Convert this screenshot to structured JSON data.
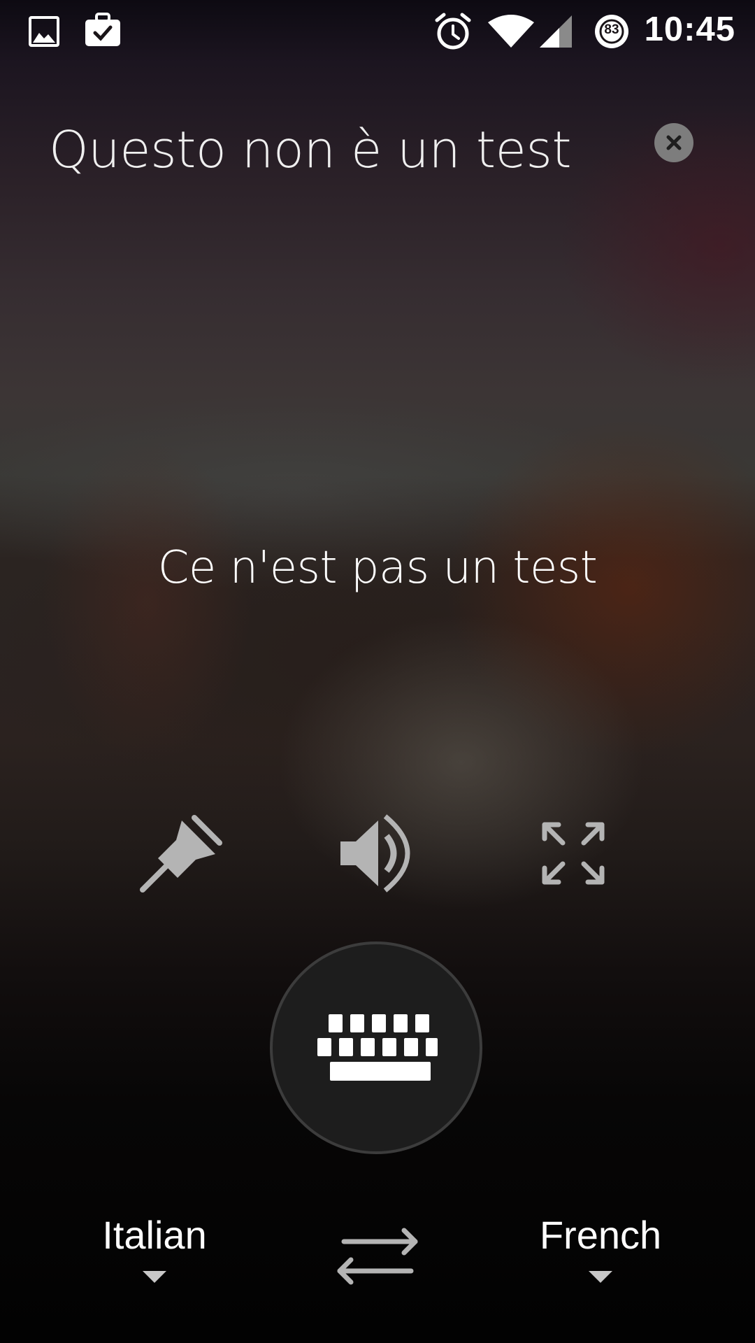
{
  "status_bar": {
    "time": "10:45",
    "battery_level": "83",
    "icons": [
      "image-icon",
      "briefcase-check-icon",
      "alarm-icon",
      "wifi-icon",
      "cell-signal-icon",
      "battery-saver-icon"
    ]
  },
  "translation": {
    "source_text": "Questo non è un test",
    "translated_text": "Ce n'est pas un test"
  },
  "actions": {
    "icons": [
      "pin-icon",
      "speaker-icon",
      "fullscreen-icon"
    ],
    "input_mode_icon": "keyboard-icon"
  },
  "languages": {
    "source": "Italian",
    "target": "French",
    "swap_icon": "swap-arrows-icon"
  },
  "colors": {
    "text": "#ffffff",
    "icon_gray": "#b4b4b4",
    "keyboard_button_bg": "#1d1d1d",
    "keyboard_button_ring": "#3c3c3c",
    "clear_button_bg": "#7d7d7d"
  }
}
